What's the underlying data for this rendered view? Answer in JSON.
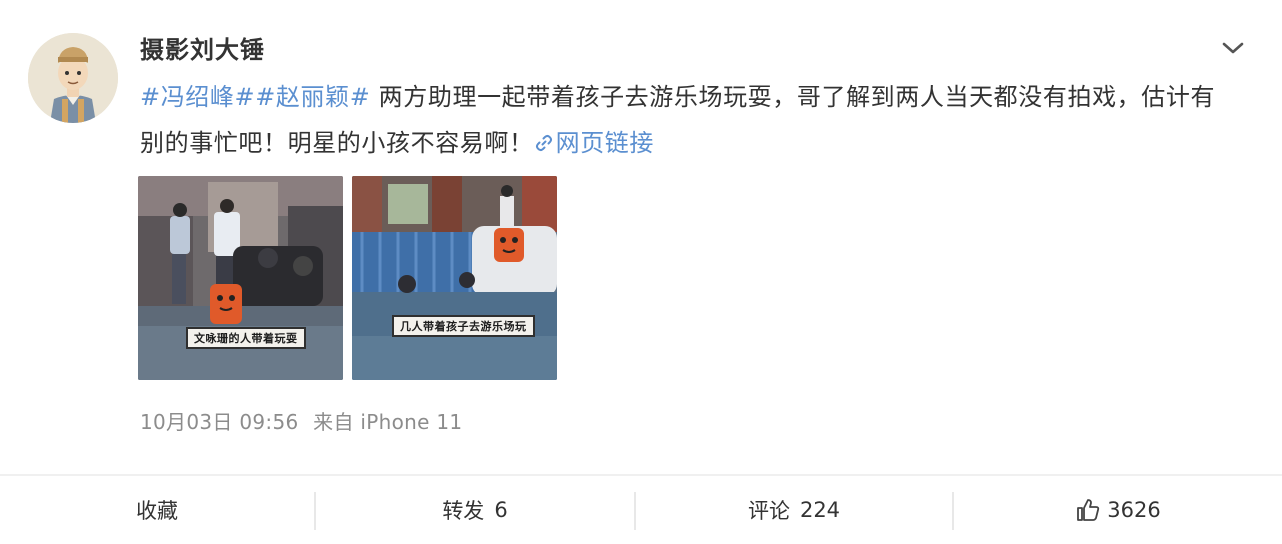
{
  "header": {
    "username": "摄影刘大锤"
  },
  "post": {
    "hashtag_1": "#冯绍峰#",
    "hashtag_2": "#赵丽颖#",
    "body": " 两方助理一起带着孩子去游乐场玩耍，哥了解到两人当天都没有拍戏，估计有别的事忙吧！明星的小孩不容易啊！",
    "link_text": "网页链接"
  },
  "images": [
    {
      "caption": "文咏珊的人带着玩耍"
    },
    {
      "caption": "几人带着孩子去游乐场玩"
    }
  ],
  "meta": {
    "date": "10月03日 09:56",
    "source": "来自 iPhone 11"
  },
  "actions": {
    "favorite_label": "收藏",
    "repost_label": "转发",
    "repost_count": "6",
    "comment_label": "评论",
    "comment_count": "224",
    "like_count": "3626"
  },
  "colors": {
    "accent": "#5b8fd0",
    "meta": "#8c8c8c",
    "text": "#333333"
  },
  "icons": [
    "avatar",
    "chevron-down-icon",
    "link-icon",
    "thumbs-up-icon"
  ]
}
